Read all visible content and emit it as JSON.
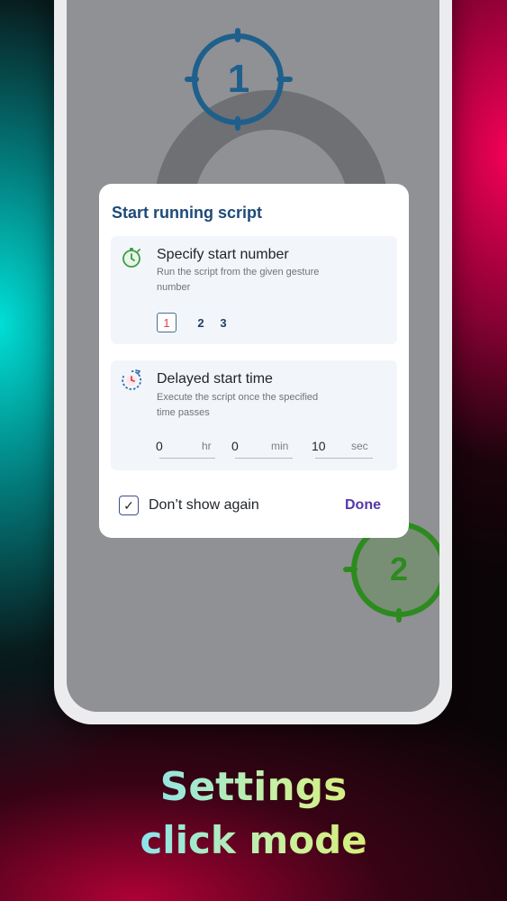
{
  "colors": {
    "title_blue": "#1d4a77",
    "done_purple": "#5637a8",
    "target1_blue": "#1f5f8c",
    "target2_green": "#2d8a1f",
    "selected_red": "#e0434a"
  },
  "targets": [
    {
      "number": "1",
      "icon": "crosshair-target-icon"
    },
    {
      "number": "2",
      "icon": "crosshair-target-icon"
    }
  ],
  "dialog": {
    "title": "Start running script",
    "start_number": {
      "icon": "stopwatch-icon",
      "title": "Specify start number",
      "description": "Run the script from the given gesture number",
      "options": [
        "1",
        "2",
        "3"
      ],
      "selected": "1"
    },
    "delayed_start": {
      "icon": "timer-clock-icon",
      "title": "Delayed start time",
      "description": "Execute the script once the specified time passes",
      "hours": {
        "value": "0",
        "unit": "hr"
      },
      "minutes": {
        "value": "0",
        "unit": "min"
      },
      "seconds": {
        "value": "10",
        "unit": "sec"
      }
    },
    "dont_show_again": {
      "label": "Don’t show again",
      "checked": true,
      "check_glyph": "✓"
    },
    "done_label": "Done"
  },
  "caption": {
    "line1": "Settings",
    "line2": "click mode"
  }
}
